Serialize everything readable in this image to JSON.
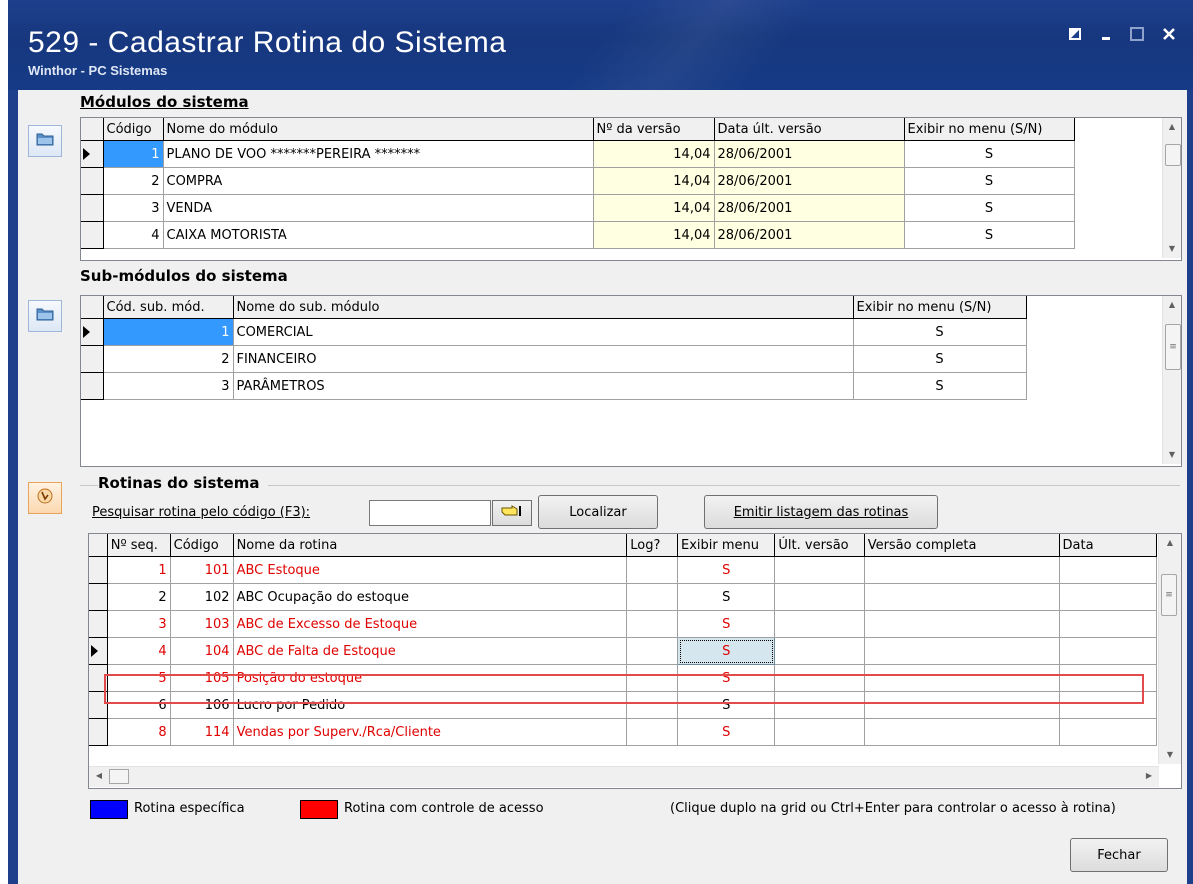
{
  "window": {
    "title": "529 - Cadastrar Rotina do Sistema",
    "subtitle": "Winthor - PC Sistemas",
    "controls": [
      "restore",
      "minimize",
      "maximize",
      "close"
    ]
  },
  "modulos": {
    "title": "Módulos do sistema",
    "columns": [
      "Código",
      "Nome do módulo",
      "Nº da versão",
      "Data últ. versão",
      "Exibir no menu (S/N)"
    ],
    "rows": [
      {
        "codigo": "1",
        "nome": "PLANO DE VOO  *******PEREIRA *******",
        "versao": "14,04",
        "data": "28/06/2001",
        "exibir": "S"
      },
      {
        "codigo": "2",
        "nome": "COMPRA",
        "versao": "14,04",
        "data": "28/06/2001",
        "exibir": "S"
      },
      {
        "codigo": "3",
        "nome": "VENDA",
        "versao": "14,04",
        "data": "28/06/2001",
        "exibir": "S"
      },
      {
        "codigo": "4",
        "nome": "CAIXA MOTORISTA",
        "versao": "14,04",
        "data": "28/06/2001",
        "exibir": "S"
      }
    ]
  },
  "submodulos": {
    "title": "Sub-módulos do sistema",
    "columns": [
      "Cód. sub. mód.",
      "Nome do sub. módulo",
      "Exibir no menu (S/N)"
    ],
    "rows": [
      {
        "codigo": "1",
        "nome": "COMERCIAL",
        "exibir": "S"
      },
      {
        "codigo": "2",
        "nome": "FINANCEIRO",
        "exibir": "S"
      },
      {
        "codigo": "3",
        "nome": "PARÂMETROS",
        "exibir": "S"
      }
    ]
  },
  "rotinas": {
    "title": "Rotinas do sistema",
    "search_label": "Pesquisar rotina pelo código (F3):",
    "search_value": "",
    "localizar_label": "Localizar",
    "emitir_label": "Emitir listagem das rotinas",
    "columns": [
      "Nº seq.",
      "Código",
      "Nome da rotina",
      "Log?",
      "Exibir menu",
      "Últ. versão",
      "Versão completa",
      "Data"
    ],
    "rows": [
      {
        "seq": "1",
        "codigo": "101",
        "nome": "ABC Estoque",
        "log": "",
        "exibir": "S",
        "ult": "",
        "completa": "",
        "data": "",
        "restrita": true
      },
      {
        "seq": "2",
        "codigo": "102",
        "nome": "ABC Ocupação do estoque",
        "log": "",
        "exibir": "S",
        "ult": "",
        "completa": "",
        "data": "",
        "restrita": false
      },
      {
        "seq": "3",
        "codigo": "103",
        "nome": "ABC de Excesso de Estoque",
        "log": "",
        "exibir": "S",
        "ult": "",
        "completa": "",
        "data": "",
        "restrita": true
      },
      {
        "seq": "4",
        "codigo": "104",
        "nome": "ABC de Falta de Estoque",
        "log": "",
        "exibir": "S",
        "ult": "",
        "completa": "",
        "data": "",
        "restrita": true
      },
      {
        "seq": "5",
        "codigo": "105",
        "nome": "Posição do estoque",
        "log": "",
        "exibir": "S",
        "ult": "",
        "completa": "",
        "data": "",
        "restrita": true
      },
      {
        "seq": "6",
        "codigo": "106",
        "nome": "Lucro por Pedido",
        "log": "",
        "exibir": "S",
        "ult": "",
        "completa": "",
        "data": "",
        "restrita": false
      },
      {
        "seq": "8",
        "codigo": "114",
        "nome": "Vendas por Superv./Rca/Cliente",
        "log": "",
        "exibir": "S",
        "ult": "",
        "completa": "",
        "data": "",
        "restrita": true
      }
    ]
  },
  "legend": {
    "especifica": "Rotina específica",
    "especifica_color": "#0000ff",
    "controle": "Rotina com controle de acesso",
    "controle_color": "#ff0000",
    "hint": "(Clique duplo na grid ou Ctrl+Enter para controlar o acesso à rotina)"
  },
  "footer": {
    "fechar_label": "Fechar"
  },
  "colors": {
    "title_bar": "#1e3f8c",
    "restricted_text": "#e00000",
    "selection": "#3399ff",
    "highlight_box": "#e34b4b"
  }
}
